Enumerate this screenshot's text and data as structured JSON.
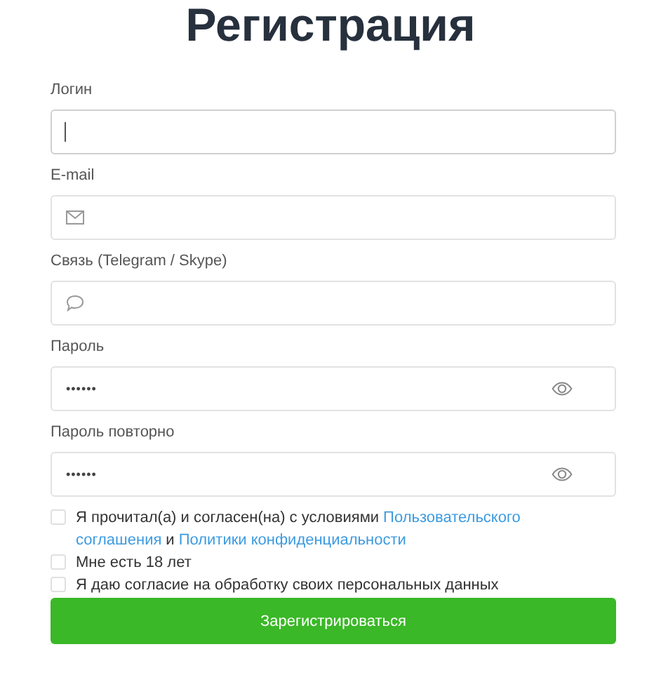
{
  "title": "Регистрация",
  "fields": [
    {
      "label": "Логин",
      "kind": "text",
      "focused": true
    },
    {
      "label": "E-mail",
      "kind": "email",
      "focused": false
    },
    {
      "label": "Связь (Telegram / Skype)",
      "kind": "contact",
      "focused": false
    },
    {
      "label": "Пароль",
      "kind": "password",
      "value": "••••••",
      "focused": false
    },
    {
      "label": "Пароль повторно",
      "kind": "password",
      "value": "••••••",
      "focused": false
    }
  ],
  "agreements": [
    {
      "checked": false,
      "lines": [
        [
          {
            "text": "Я прочитал(а) и согласен(на) с условиями",
            "link": false
          },
          {
            "text": "Пользовательского",
            "link": true
          }
        ],
        [
          {
            "text": "соглашения",
            "link": true
          },
          {
            "text": "и",
            "link": false
          },
          {
            "text": "Политики конфиденциальности",
            "link": true
          }
        ]
      ]
    },
    {
      "checked": false,
      "lines": [
        [
          {
            "text": "Мне есть 18 лет",
            "link": false
          }
        ]
      ]
    },
    {
      "checked": false,
      "lines": [
        [
          {
            "text": "Я даю согласие на обработку своих персональных данных",
            "link": false
          }
        ]
      ]
    }
  ],
  "submit": "Зарегистрироваться"
}
